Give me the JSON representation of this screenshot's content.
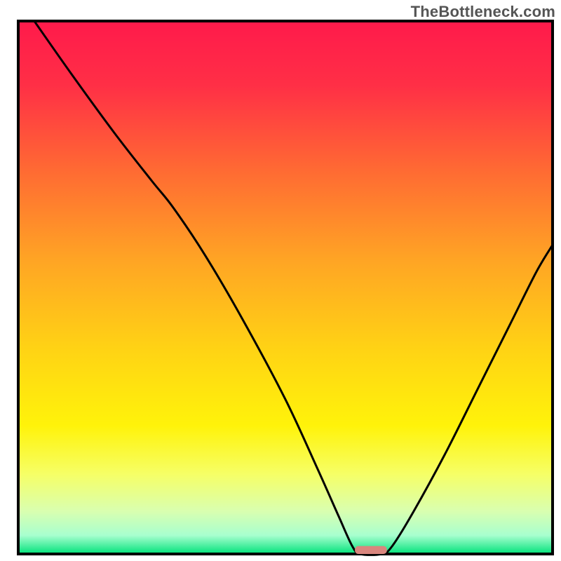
{
  "watermark": "TheBottleneck.com",
  "chart_data": {
    "type": "line",
    "title": "",
    "xlabel": "",
    "ylabel": "",
    "xlim": [
      0,
      100
    ],
    "ylim": [
      0,
      100
    ],
    "legend": null,
    "background_gradient": {
      "stops": [
        {
          "offset": 0.0,
          "color": "#ff1a4b"
        },
        {
          "offset": 0.12,
          "color": "#ff2f46"
        },
        {
          "offset": 0.28,
          "color": "#ff6a33"
        },
        {
          "offset": 0.45,
          "color": "#ffa524"
        },
        {
          "offset": 0.62,
          "color": "#ffd414"
        },
        {
          "offset": 0.76,
          "color": "#fff30a"
        },
        {
          "offset": 0.85,
          "color": "#f6ff66"
        },
        {
          "offset": 0.92,
          "color": "#d9ffb0"
        },
        {
          "offset": 0.965,
          "color": "#a8ffcf"
        },
        {
          "offset": 1.0,
          "color": "#00e27a"
        }
      ]
    },
    "marker": {
      "x": 66,
      "y": 0,
      "color": "#d9867e",
      "width": 6,
      "height": 1.5
    },
    "series": [
      {
        "name": "bottleneck-curve",
        "color": "#000000",
        "points": [
          {
            "x": 3,
            "y": 100
          },
          {
            "x": 10,
            "y": 90
          },
          {
            "x": 18,
            "y": 79
          },
          {
            "x": 25,
            "y": 70
          },
          {
            "x": 29,
            "y": 65
          },
          {
            "x": 35,
            "y": 56
          },
          {
            "x": 42,
            "y": 44
          },
          {
            "x": 50,
            "y": 29
          },
          {
            "x": 56,
            "y": 16
          },
          {
            "x": 60,
            "y": 7
          },
          {
            "x": 62.5,
            "y": 1.5
          },
          {
            "x": 64,
            "y": 0
          },
          {
            "x": 68,
            "y": 0
          },
          {
            "x": 70,
            "y": 1.5
          },
          {
            "x": 74,
            "y": 8
          },
          {
            "x": 80,
            "y": 19
          },
          {
            "x": 86,
            "y": 31
          },
          {
            "x": 92,
            "y": 43
          },
          {
            "x": 97,
            "y": 53
          },
          {
            "x": 100,
            "y": 58
          }
        ]
      }
    ]
  }
}
